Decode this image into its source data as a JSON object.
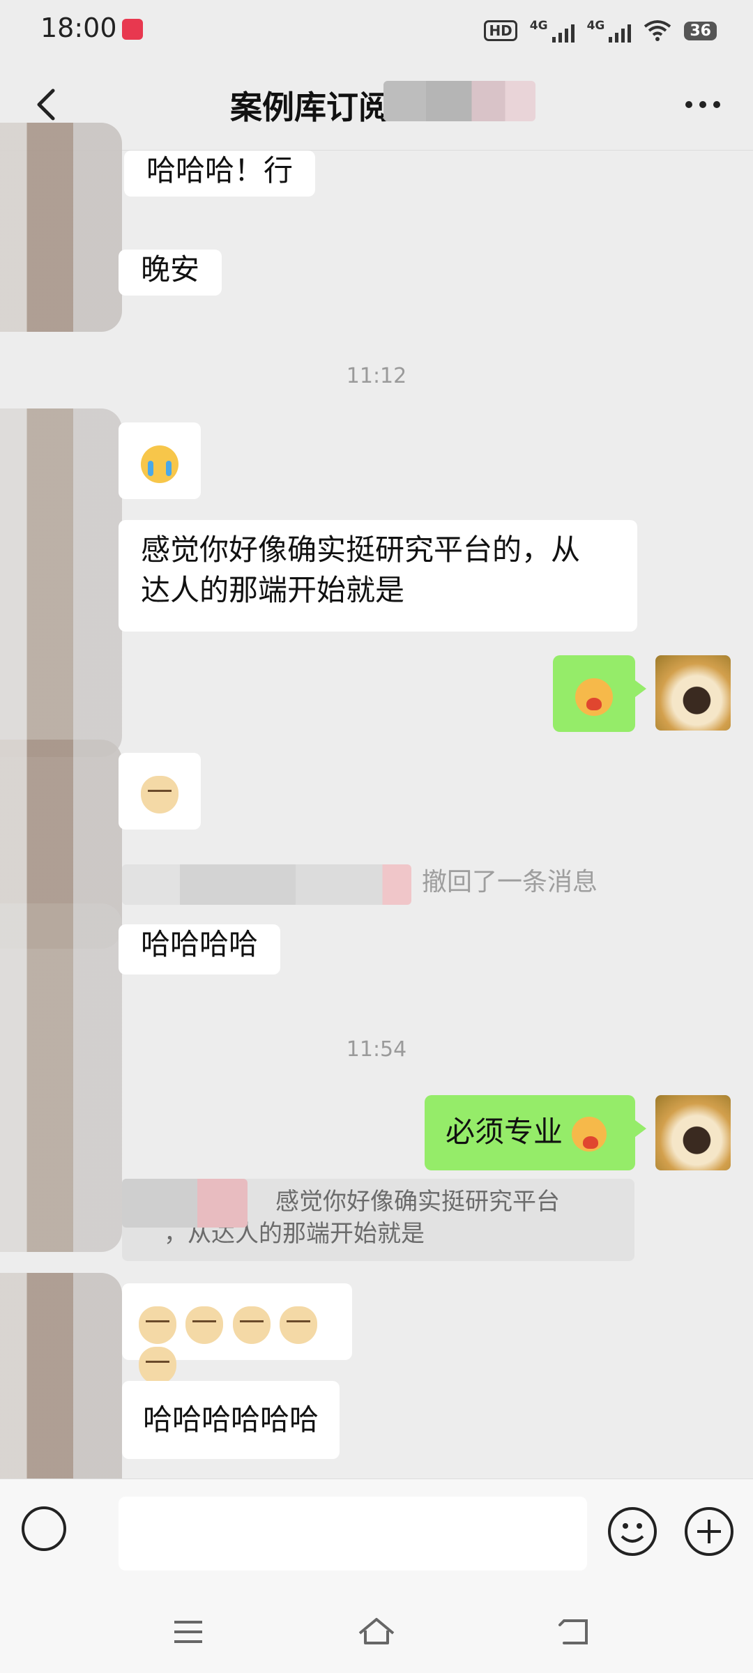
{
  "status_bar": {
    "time": "18:00",
    "hd_label": "HD",
    "sim_label_1": "4G",
    "sim_label_2": "4G",
    "battery": "36",
    "icons": [
      "notification-app-icon",
      "hd-icon",
      "signal-icon",
      "signal-icon",
      "wifi-icon",
      "battery-icon"
    ]
  },
  "header": {
    "title": "案例库订阅",
    "back_icon": "chevron-left-icon",
    "more_icon": "more-horizontal-icon"
  },
  "messages": [
    {
      "side": "other",
      "type": "text",
      "text": "哈哈哈！行"
    },
    {
      "side": "other",
      "type": "text",
      "text": "晚安"
    },
    {
      "type": "timestamp",
      "text": "11:12"
    },
    {
      "side": "other",
      "type": "emoji",
      "emoji": "cry-emoji"
    },
    {
      "side": "other",
      "type": "text",
      "lines": [
        "感觉你好像确实挺研究平台的，从",
        "达人的那端开始就是"
      ]
    },
    {
      "side": "me",
      "type": "emoji",
      "emoji": "heart-emoji"
    },
    {
      "side": "other",
      "type": "emoji",
      "emoji": "doge-emoji"
    },
    {
      "type": "recall",
      "text": "撤回了一条消息"
    },
    {
      "side": "other",
      "type": "text",
      "text": "哈哈哈哈"
    },
    {
      "type": "timestamp",
      "text": "11:54"
    },
    {
      "side": "me",
      "type": "text",
      "text": "必须专业"
    },
    {
      "type": "quote",
      "lines": [
        "感觉你好像确实挺研究平台",
        "，从达人的那端开始就是"
      ]
    },
    {
      "side": "other",
      "type": "emoji",
      "emoji": "doge-emoji",
      "count": 5
    },
    {
      "side": "other",
      "type": "text",
      "text": "哈哈哈哈哈哈"
    }
  ],
  "input_bar": {
    "placeholder": "",
    "icons": [
      "voice-icon",
      "smile-icon",
      "plus-icon"
    ]
  },
  "system_nav": [
    "menu-icon",
    "home-icon",
    "back-icon"
  ],
  "colors": {
    "background": "#ededed",
    "my_bubble": "#95ec69",
    "other_bubble": "#ffffff",
    "timestamp": "#9a9a9a"
  }
}
